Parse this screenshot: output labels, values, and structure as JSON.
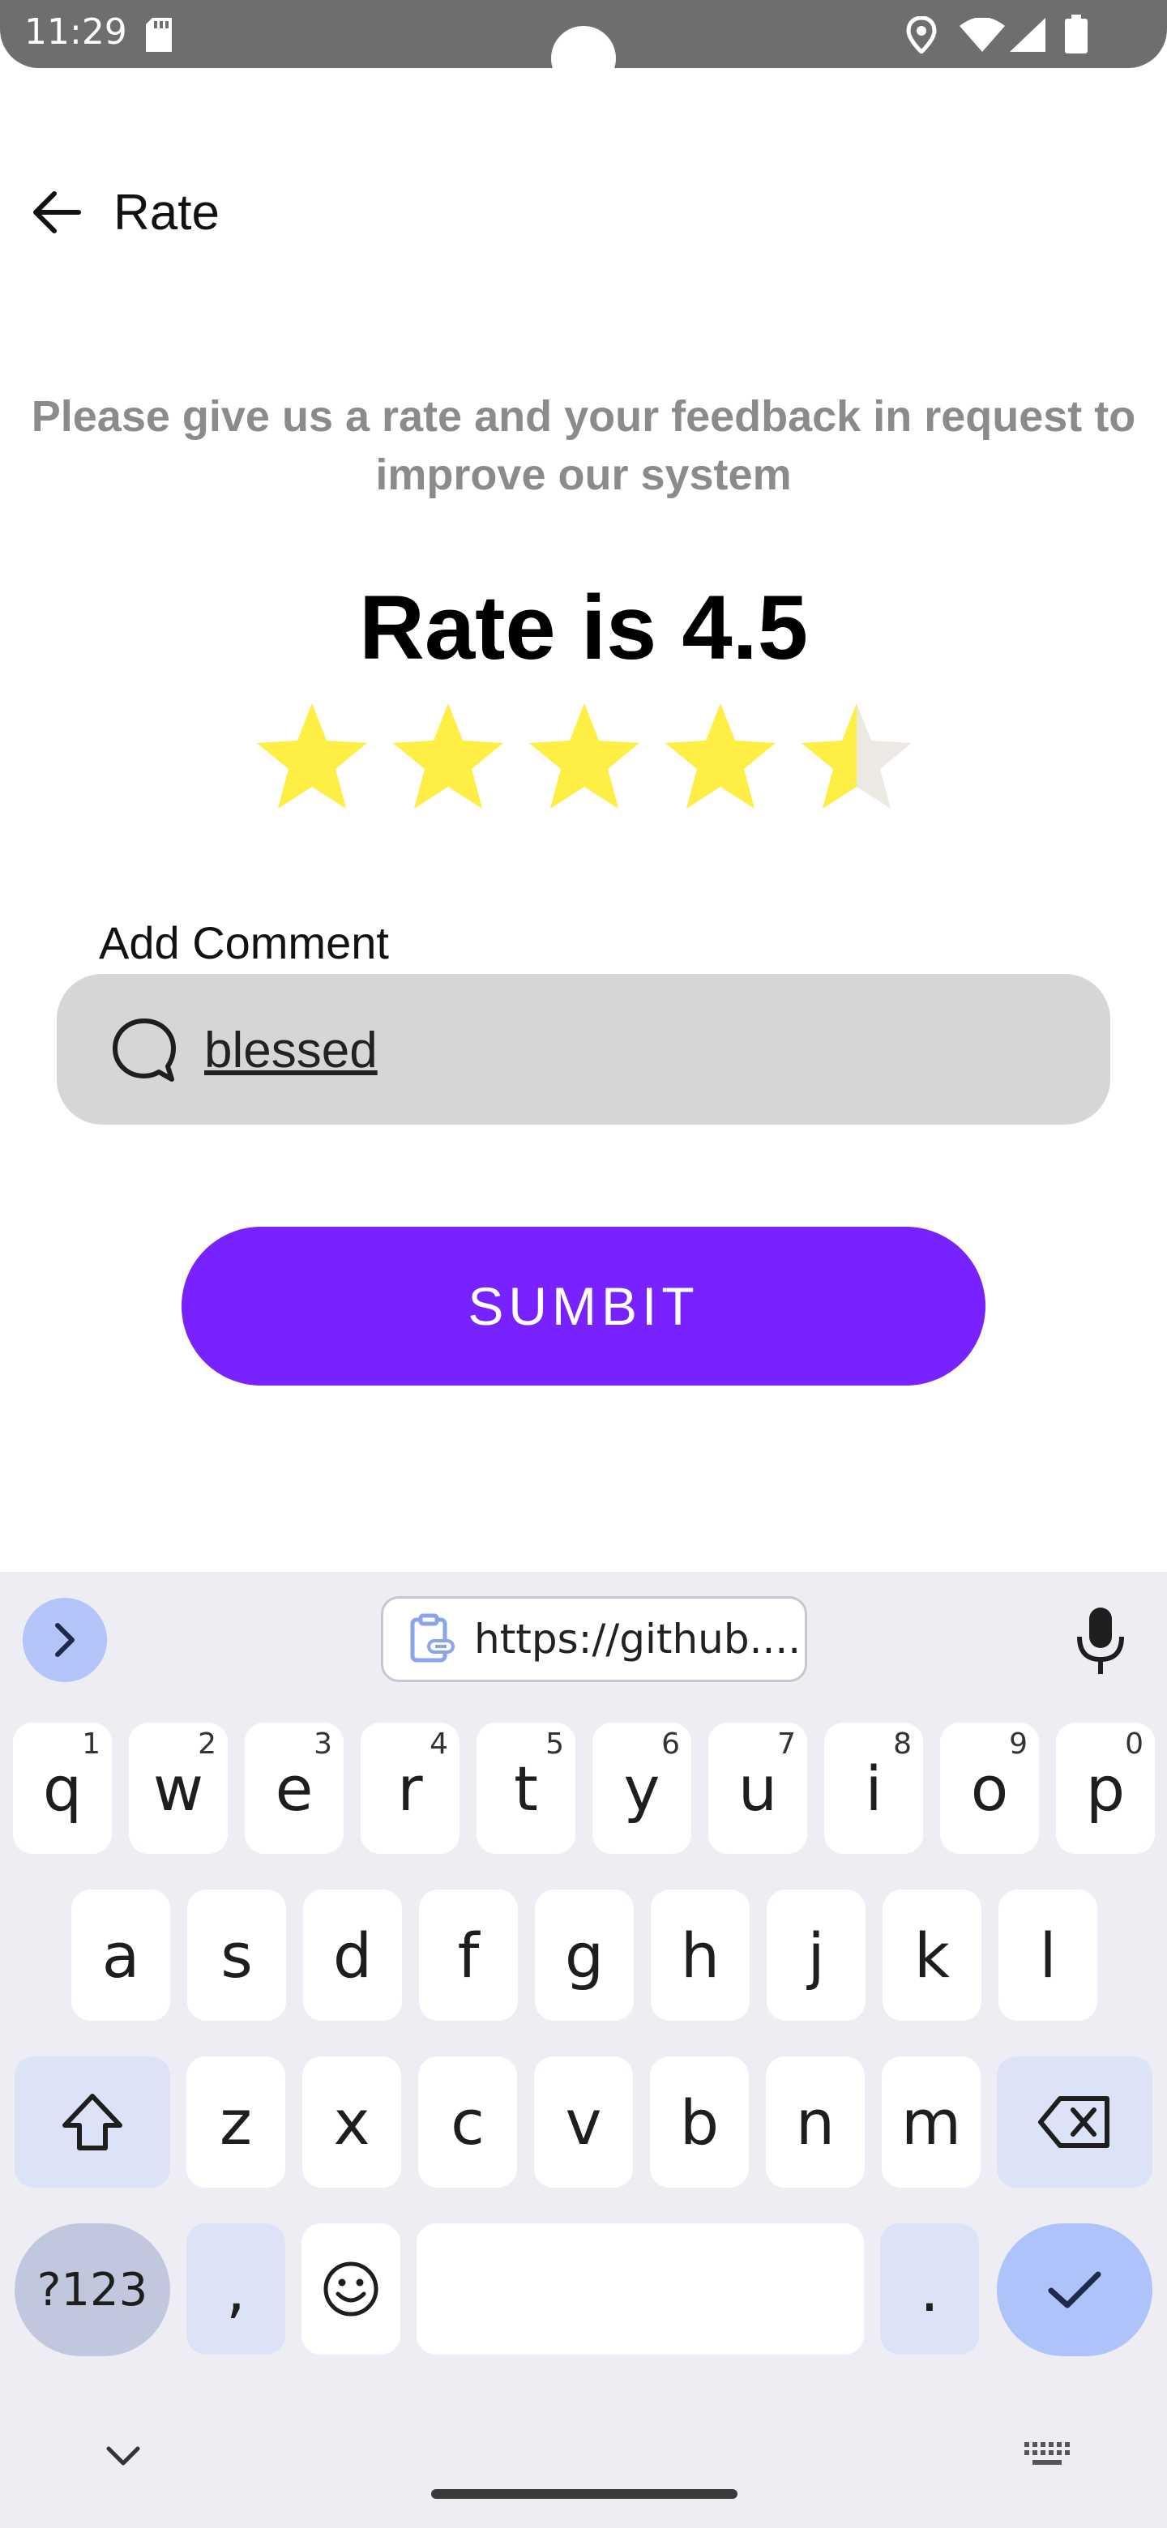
{
  "status_bar": {
    "time": "11:29"
  },
  "header": {
    "title": "Rate"
  },
  "content": {
    "subtitle": "Please give us a rate and your feedback in request to improve our system",
    "rate_text": "Rate is 4.5",
    "rating_value": 4.5,
    "rating_max": 5,
    "star_color": "#ffee44",
    "star_empty_color": "#ebe9e1",
    "comment_label": "Add Comment",
    "comment_value": "blessed",
    "submit_label": "SUMBIT",
    "accent_color": "#7722ff"
  },
  "keyboard": {
    "clipboard_text": "https://github....",
    "row1": [
      {
        "key": "q",
        "num": "1"
      },
      {
        "key": "w",
        "num": "2"
      },
      {
        "key": "e",
        "num": "3"
      },
      {
        "key": "r",
        "num": "4"
      },
      {
        "key": "t",
        "num": "5"
      },
      {
        "key": "y",
        "num": "6"
      },
      {
        "key": "u",
        "num": "7"
      },
      {
        "key": "i",
        "num": "8"
      },
      {
        "key": "o",
        "num": "9"
      },
      {
        "key": "p",
        "num": "0"
      }
    ],
    "row2": [
      "a",
      "s",
      "d",
      "f",
      "g",
      "h",
      "j",
      "k",
      "l"
    ],
    "row3": [
      "z",
      "x",
      "c",
      "v",
      "b",
      "n",
      "m"
    ],
    "symbols_label": "?123",
    "comma": ",",
    "period": "."
  }
}
